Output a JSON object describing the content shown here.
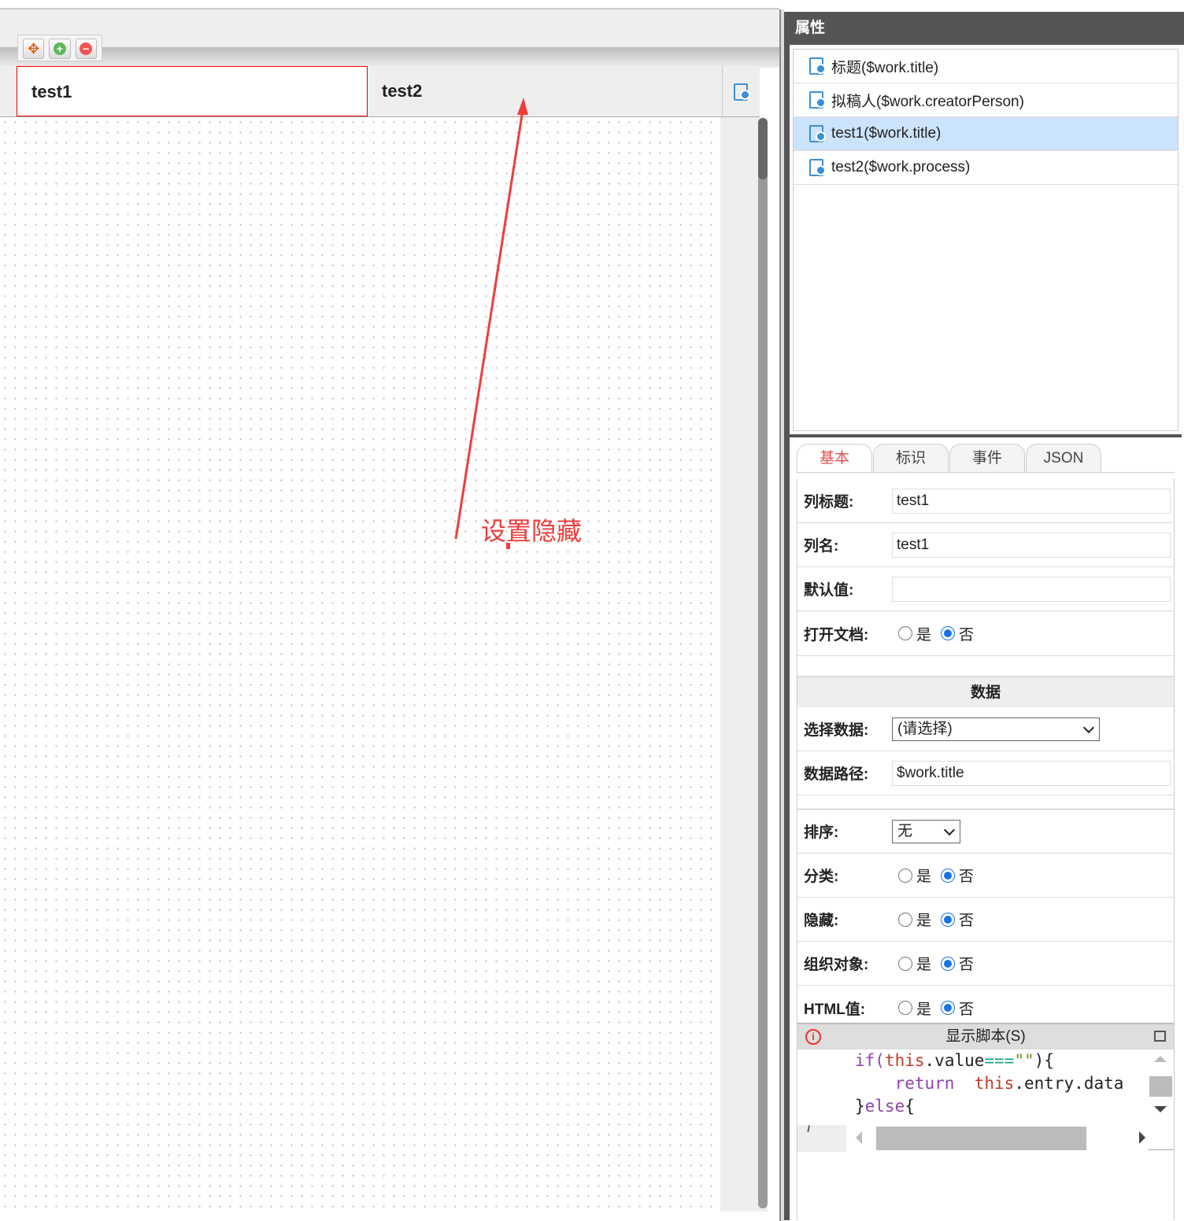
{
  "toolbar": {
    "icons": [
      "move-icon",
      "add-icon",
      "remove-icon"
    ]
  },
  "columns": [
    {
      "label": "test1"
    },
    {
      "label": "test2"
    }
  ],
  "annotation": {
    "text": "设置隐藏",
    "color": "#f03c3c"
  },
  "panel": {
    "title": "属性"
  },
  "list": [
    {
      "label": "标题($work.title)"
    },
    {
      "label": "拟稿人($work.creatorPerson)"
    },
    {
      "label": "test1($work.title)",
      "selected": true
    },
    {
      "label": "test2($work.process)"
    }
  ],
  "tabs": [
    "基本",
    "标识",
    "事件",
    "JSON"
  ],
  "form": {
    "col_title": {
      "label": "列标题:",
      "value": "test1"
    },
    "col_name": {
      "label": "列名:",
      "value": "test1"
    },
    "default": {
      "label": "默认值:",
      "value": ""
    },
    "open_doc": {
      "label": "打开文档:",
      "yes": "是",
      "no": "否",
      "selected": "否"
    },
    "data_section": "数据",
    "select_data": {
      "label": "选择数据:",
      "value": "(请选择)"
    },
    "data_path": {
      "label": "数据路径:",
      "value": "$work.title"
    },
    "sort": {
      "label": "排序:",
      "value": "无"
    },
    "category": {
      "label": "分类:",
      "yes": "是",
      "no": "否",
      "selected": "否"
    },
    "hidden": {
      "label": "隐藏:",
      "yes": "是",
      "no": "否",
      "selected": "否"
    },
    "org": {
      "label": "组织对象:",
      "yes": "是",
      "no": "否",
      "selected": "否"
    },
    "html": {
      "label": "HTML值:",
      "yes": "是",
      "no": "否",
      "selected": "否"
    }
  },
  "script": {
    "title": "显示脚本(S)",
    "lines": {
      "l1a": "if(",
      "l1b": "this",
      ".": ".",
      "l1c": "value",
      "l1d": "===",
      "l1e": "\"\"",
      "l1f": "){",
      "l2a": "return",
      "l2b": "this",
      "l2c": ".entry.data",
      "l3a": "}",
      "l3b": "else",
      "l3c": "{"
    }
  }
}
